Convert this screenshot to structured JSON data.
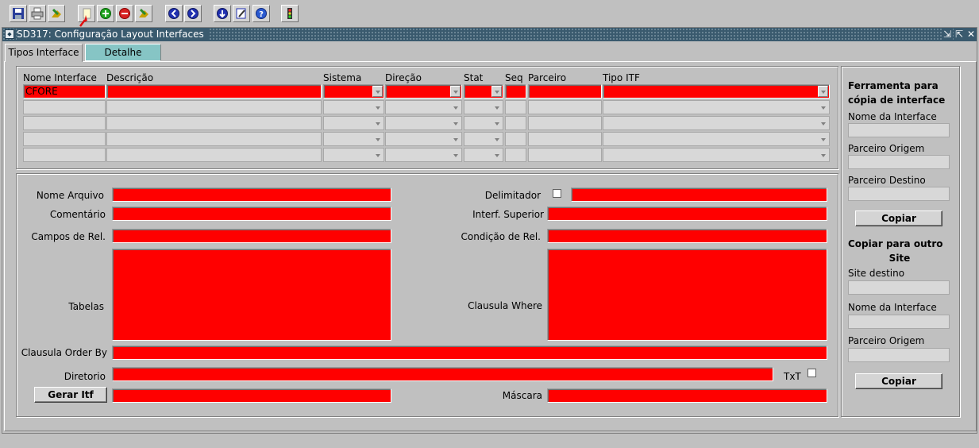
{
  "window": {
    "title": "SD317: Configuração Layout Interfaces"
  },
  "tabs": {
    "tipos": "Tipos Interface",
    "detalhe": "Detalhe"
  },
  "grid": {
    "headers": [
      "Nome Interface",
      "Descrição",
      "Sistema",
      "Direção",
      "Stat",
      "Seq",
      "Parceiro",
      "Tipo ITF"
    ],
    "first_row_value": "CFORE"
  },
  "detail": {
    "nome_arquivo": "Nome Arquivo",
    "comentario": "Comentário",
    "campos_rel": "Campos de Rel.",
    "tabelas": "Tabelas",
    "clausula_order": "Clausula Order By",
    "diretorio": "Diretorio",
    "gerar_itf": "Gerar Itf",
    "delimitador": "Delimitador",
    "interf_superior": "Interf. Superior",
    "condicao_rel": "Condição de Rel.",
    "clausula_where": "Clausula Where",
    "txt": "TxT",
    "mascara": "Máscara"
  },
  "copy_tool": {
    "title_line1": "Ferramenta para",
    "title_line2": "cópia de interface",
    "nome_interface": "Nome da Interface",
    "parceiro_origem": "Parceiro Origem",
    "parceiro_destino": "Parceiro Destino",
    "copiar": "Copiar"
  },
  "copy_site": {
    "title_line1": "Copiar para outro",
    "title_line2": "Site",
    "site_destino": "Site destino",
    "nome_interface": "Nome da Interface",
    "parceiro_origem": "Parceiro Origem",
    "copiar": "Copiar"
  },
  "icons": [
    "save-icon",
    "print-icon",
    "exit-icon",
    "new-record-icon",
    "insert-icon",
    "delete-icon",
    "exit-icon",
    "previous-icon",
    "next-icon",
    "query-icon",
    "edit-icon",
    "help-icon",
    "traffic-light-icon"
  ],
  "colors": {
    "required_field": "#ff0000",
    "title_bar": "#3a5a6e",
    "detail_tab": "#86c5c5"
  }
}
